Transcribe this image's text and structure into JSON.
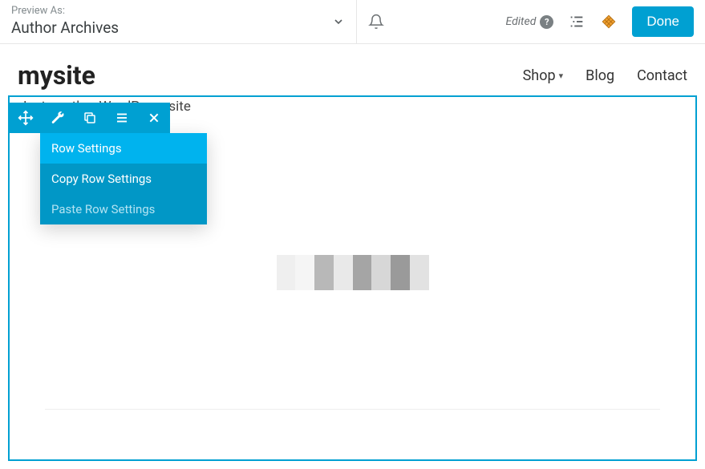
{
  "topbar": {
    "preview_label": "Preview As:",
    "preview_value": "Author Archives",
    "edited_label": "Edited",
    "done_label": "Done"
  },
  "site": {
    "title": "mysite",
    "tagline": "Just another WordPress site"
  },
  "nav": {
    "items": [
      {
        "label": "Shop",
        "has_children": true
      },
      {
        "label": "Blog",
        "has_children": false
      },
      {
        "label": "Contact",
        "has_children": false
      }
    ]
  },
  "dropdown": {
    "items": [
      {
        "label": "Row Settings",
        "state": "active"
      },
      {
        "label": "Copy Row Settings",
        "state": "normal"
      },
      {
        "label": "Paste Row Settings",
        "state": "disabled"
      }
    ]
  },
  "colors": {
    "accent": "#00a0d2",
    "dropdown_bg": "#0197c6",
    "dropdown_active": "#00b3ee"
  }
}
